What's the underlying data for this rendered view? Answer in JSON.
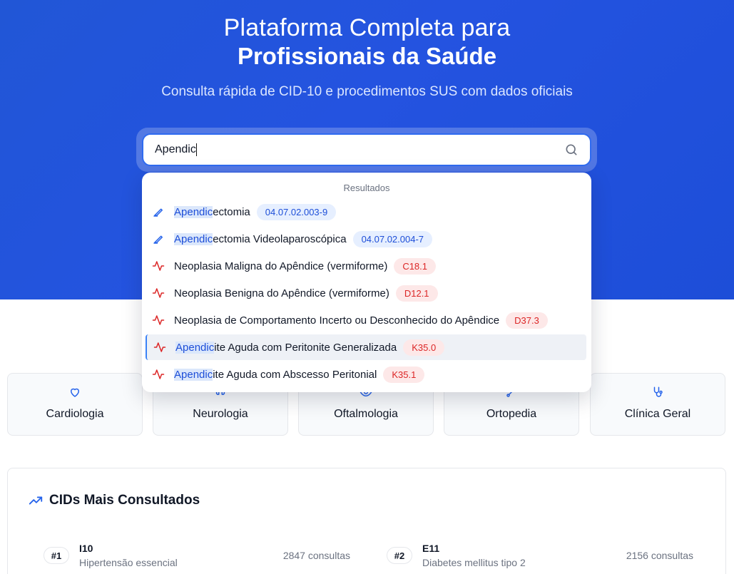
{
  "hero": {
    "title_line1": "Plataforma Completa para",
    "title_line2": "Profissionais da Saúde",
    "subtitle": "Consulta rápida de CID-10 e procedimentos SUS com dados oficiais"
  },
  "search": {
    "value": "Apendic",
    "icon": "search-icon"
  },
  "dropdown": {
    "header": "Resultados",
    "items": [
      {
        "type": "procedure",
        "icon": "scalpel-icon",
        "highlight": "Apendic",
        "rest": "ectomia",
        "code": "04.07.02.003-9"
      },
      {
        "type": "procedure",
        "icon": "scalpel-icon",
        "highlight": "Apendic",
        "rest": "ectomia Videolaparoscópica",
        "code": "04.07.02.004-7"
      },
      {
        "type": "cid",
        "icon": "activity-icon",
        "highlight": "",
        "rest": "Neoplasia Maligna do Apêndice (vermiforme)",
        "code": "C18.1"
      },
      {
        "type": "cid",
        "icon": "activity-icon",
        "highlight": "",
        "rest": "Neoplasia Benigna do Apêndice (vermiforme)",
        "code": "D12.1"
      },
      {
        "type": "cid",
        "icon": "activity-icon",
        "highlight": "",
        "rest": "Neoplasia de Comportamento Incerto ou Desconhecido do Apêndice",
        "code": "D37.3"
      },
      {
        "type": "cid",
        "icon": "activity-icon",
        "highlight": "Apendic",
        "rest": "ite Aguda com Peritonite Generalizada",
        "code": "K35.0",
        "active": true
      },
      {
        "type": "cid",
        "icon": "activity-icon",
        "highlight": "Apendic",
        "rest": "ite Aguda com Abscesso Peritonial",
        "code": "K35.1"
      }
    ]
  },
  "specialties": [
    {
      "label": "Cardiologia",
      "icon": "heart-icon"
    },
    {
      "label": "Neurologia",
      "icon": "brain-icon"
    },
    {
      "label": "Oftalmologia",
      "icon": "eye-icon"
    },
    {
      "label": "Ortopedia",
      "icon": "bone-icon"
    },
    {
      "label": "Clínica Geral",
      "icon": "stethoscope-icon"
    }
  ],
  "top_cids": {
    "title": "CIDs Mais Consultados",
    "icon": "trending-up-icon",
    "items": [
      {
        "rank": "#1",
        "code": "I10",
        "description": "Hipertensão essencial",
        "count": "2847 consultas"
      },
      {
        "rank": "#2",
        "code": "E11",
        "description": "Diabetes mellitus tipo 2",
        "count": "2156 consultas"
      }
    ]
  },
  "colors": {
    "hero_bg": "#2453e0",
    "accent_blue": "#1d4ed8",
    "cid_red": "#dc2626",
    "proc_badge_bg": "#e6efff",
    "cid_badge_bg": "#fde8e8"
  }
}
